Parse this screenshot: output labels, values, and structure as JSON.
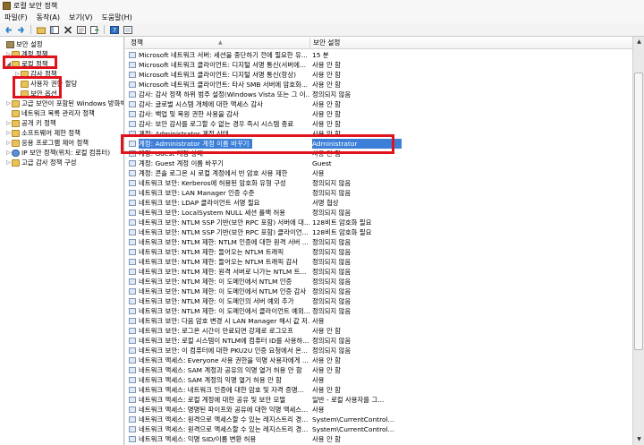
{
  "window": {
    "title": "로컬 보안 정책"
  },
  "menu": [
    "파일(F)",
    "동작(A)",
    "보기(V)",
    "도움말(H)"
  ],
  "toolbar": [
    "back-icon",
    "forward-icon",
    "folder-up-icon",
    "show-tree-icon",
    "delete-icon",
    "properties-icon",
    "export-icon",
    "help-icon",
    "view-icon"
  ],
  "tree": [
    {
      "label": "보안 설정",
      "expander": "",
      "icon": "shield"
    },
    {
      "label": "계정 정책",
      "expander": "▷",
      "icon": "folder"
    },
    {
      "label": "로컬 정책",
      "expander": "◢",
      "icon": "folder"
    },
    {
      "label": "감사 정책",
      "expander": "▷",
      "icon": "folder"
    },
    {
      "label": "사용자 권한 할당",
      "expander": "",
      "icon": "folder"
    },
    {
      "label": "보안 옵션",
      "expander": "",
      "icon": "folder"
    },
    {
      "label": "고급 보안이 포함된 Windows 방화벽",
      "expander": "▷",
      "icon": "folder"
    },
    {
      "label": "네트워크 목록 관리자 정책",
      "expander": "",
      "icon": "folder"
    },
    {
      "label": "공개 키 정책",
      "expander": "▷",
      "icon": "folder"
    },
    {
      "label": "소프트웨어 제한 정책",
      "expander": "▷",
      "icon": "folder"
    },
    {
      "label": "응용 프로그램 제어 정책",
      "expander": "▷",
      "icon": "folder"
    },
    {
      "label": "IP 보안 정책(위치: 로컬 컴퓨터)",
      "expander": "▷",
      "icon": "net"
    },
    {
      "label": "고급 감사 정책 구성",
      "expander": "▷",
      "icon": "folder"
    }
  ],
  "columns": {
    "policy": "정책",
    "setting": "보안 설정"
  },
  "rows": [
    {
      "policy": "Microsoft 네트워크 서버: 세션을 중단하기 전에 필요한 유...",
      "setting": "15 분"
    },
    {
      "policy": "Microsoft 네트워크 클라이언트: 디지털 서명 통신(서버에...",
      "setting": "사용 안 함"
    },
    {
      "policy": "Microsoft 네트워크 클라이언트: 디지털 서명 통신(항상)",
      "setting": "사용 안 함"
    },
    {
      "policy": "Microsoft 네트워크 클라이언트: 타사 SMB 서버에 암호화...",
      "setting": "사용 안 함"
    },
    {
      "policy": "감사: 감사 정책 하위 범주 설정(Windows Vista 또는 그 이...",
      "setting": "정의되지 않음"
    },
    {
      "policy": "감사: 글로벌 시스템 개체에 대한 액세스 감사",
      "setting": "사용 안 함"
    },
    {
      "policy": "감사: 백업 및 복원 권한 사용을 감사",
      "setting": "사용 안 함"
    },
    {
      "policy": "감사: 보안 감사를 로그할 수 없는 경우 즉시 시스템 종료",
      "setting": "사용 안 함"
    },
    {
      "policy": "계정: Administrator 계정 상태",
      "setting": "사용 안 함"
    },
    {
      "policy": "계정: Administrator 계정 이름 바꾸기",
      "setting": "Administrator",
      "selected": true
    },
    {
      "policy": "계정: Guest 계정 상태",
      "setting": "사용 안 함"
    },
    {
      "policy": "계정: Guest 계정 이름 바꾸기",
      "setting": "Guest"
    },
    {
      "policy": "계정: 콘솔 로그온 시 로컬 계정에서 빈 암호 사용 제한",
      "setting": "사용"
    },
    {
      "policy": "네트워크 보안: Kerberos에 허용된 암호화 유형 구성",
      "setting": "정의되지 않음"
    },
    {
      "policy": "네트워크 보안: LAN Manager 인증 수준",
      "setting": "정의되지 않음"
    },
    {
      "policy": "네트워크 보안: LDAP 클라이언트 서명 필요",
      "setting": "서명 협상"
    },
    {
      "policy": "네트워크 보안: LocalSystem NULL 세션 폴백 허용",
      "setting": "정의되지 않음"
    },
    {
      "policy": "네트워크 보안: NTLM SSP 기반(보안 RPC 포함) 서버에 대...",
      "setting": "128비트 암호화 필요"
    },
    {
      "policy": "네트워크 보안: NTLM SSP 기반(보안 RPC 포함) 클라이언...",
      "setting": "128비트 암호화 필요"
    },
    {
      "policy": "네트워크 보안: NTLM 제한: NTLM 인증에 대한 원격 서버 ...",
      "setting": "정의되지 않음"
    },
    {
      "policy": "네트워크 보안: NTLM 제한: 들어오는 NTLM 트래픽",
      "setting": "정의되지 않음"
    },
    {
      "policy": "네트워크 보안: NTLM 제한: 들어오는 NTLM 트래픽 감사",
      "setting": "정의되지 않음"
    },
    {
      "policy": "네트워크 보안: NTLM 제한: 원격 서버로 나가는 NTLM 트...",
      "setting": "정의되지 않음"
    },
    {
      "policy": "네트워크 보안: NTLM 제한: 이 도메인에서 NTLM 인증",
      "setting": "정의되지 않음"
    },
    {
      "policy": "네트워크 보안: NTLM 제한: 이 도메인에서 NTLM 인증 감사",
      "setting": "정의되지 않음"
    },
    {
      "policy": "네트워크 보안: NTLM 제한: 이 도메인의 서버 예외 추가",
      "setting": "정의되지 않음"
    },
    {
      "policy": "네트워크 보안: NTLM 제한: 이 도메인에서 클라이언트 예외...",
      "setting": "정의되지 않음"
    },
    {
      "policy": "네트워크 보안: 다음 암호 변경 시 LAN Manager 해시 값 저...",
      "setting": "사용"
    },
    {
      "policy": "네트워크 보안: 로그온 시간이 만료되면 강제로 로그오프",
      "setting": "사용 안 함"
    },
    {
      "policy": "네트워크 보안: 로컬 시스템이 NTLM에 컴퓨터 ID를 사용하...",
      "setting": "정의되지 않음"
    },
    {
      "policy": "네트워크 보안: 이 컴퓨터에 대한 PKU2U 인증 요청에서 온...",
      "setting": "정의되지 않음"
    },
    {
      "policy": "네트워크 액세스: Everyone 사용 권한을 익명 사용자에게 ...",
      "setting": "사용 안 함"
    },
    {
      "policy": "네트워크 액세스: SAM 계정과 공유의 익명 열거 허용 안 함",
      "setting": "사용 안 함"
    },
    {
      "policy": "네트워크 액세스: SAM 계정의 익명 열거 허용 안 함",
      "setting": "사용"
    },
    {
      "policy": "네트워크 액세스: 네트워크 인증에 대한 암호 및 자격 증명...",
      "setting": "사용 안 함"
    },
    {
      "policy": "네트워크 액세스: 로컬 계정에 대한 공유 및 보안 모델",
      "setting": "일반 - 로컬 사용자를 그..."
    },
    {
      "policy": "네트워크 액세스: 명명된 파이프와 공유에 대한 익명 액세스...",
      "setting": "사용"
    },
    {
      "policy": "네트워크 액세스: 원격으로 액세스할 수 있는 레지스트리 경...",
      "setting": "System\\CurrentControl..."
    },
    {
      "policy": "네트워크 액세스: 원격으로 액세스할 수 있는 레지스트리 경...",
      "setting": "System\\CurrentControl..."
    },
    {
      "policy": "네트워크 액세스: 익명 SID/이름 변환 허용",
      "setting": "사용 안 함"
    }
  ]
}
